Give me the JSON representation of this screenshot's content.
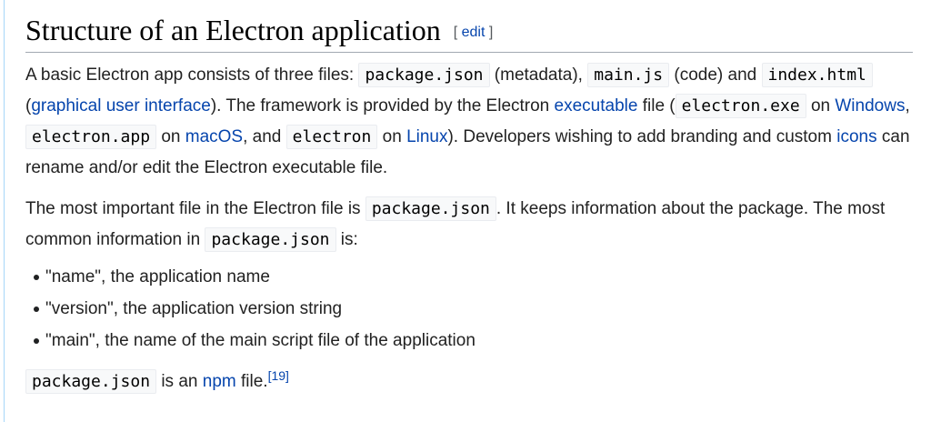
{
  "heading": {
    "title": "Structure of an Electron application",
    "edit_open": "[",
    "edit_label": "edit",
    "edit_close": "]"
  },
  "para1": {
    "t1": "A basic Electron app consists of three files: ",
    "c1": "package.json",
    "t2": " (metadata), ",
    "c2": "main.js",
    "t3": " (code) and ",
    "c3": "index.html",
    "t4": " (",
    "link1": "graphical user interface",
    "t5": "). The framework is provided by the Electron ",
    "link2": "executable",
    "t6": " file (",
    "c4": "electron.exe",
    "t7": " on ",
    "link3": "Windows",
    "t8": ", ",
    "c5": "electron.app",
    "t9": " on ",
    "link4": "macOS",
    "t10": ", and ",
    "c6": "electron",
    "t11": " on ",
    "link5": "Linux",
    "t12": "). Developers wishing to add branding and custom ",
    "link6": "icons",
    "t13": " can rename and/or edit the Electron executable file."
  },
  "para2": {
    "t1": "The most important file in the Electron file is ",
    "c1": "package.json",
    "t2": ". It keeps information about the package. The most common information in ",
    "c2": "package.json",
    "t3": " is:"
  },
  "list": [
    "\"name\", the application name",
    "\"version\", the application version string",
    "\"main\", the name of the main script file of the application"
  ],
  "para3": {
    "c1": "package.json",
    "t1": " is an ",
    "link1": "npm",
    "t2": " file.",
    "ref": "[19]"
  }
}
